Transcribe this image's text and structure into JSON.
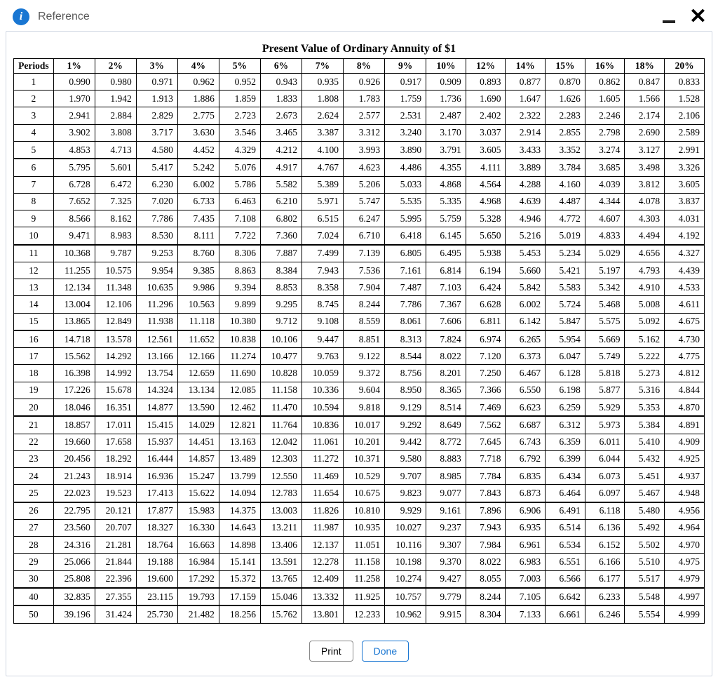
{
  "window": {
    "title": "Reference",
    "info_glyph": "i",
    "minimize_label": "minimize",
    "close_label": "close"
  },
  "table": {
    "title": "Present Value of Ordinary Annuity of $1",
    "periods_header": "Periods",
    "rate_headers": [
      "1%",
      "2%",
      "3%",
      "4%",
      "5%",
      "6%",
      "7%",
      "8%",
      "9%",
      "10%",
      "12%",
      "14%",
      "15%",
      "16%",
      "18%",
      "20%"
    ]
  },
  "buttons": {
    "print": "Print",
    "done": "Done"
  },
  "chart_data": {
    "type": "table",
    "title": "Present Value of Ordinary Annuity of $1",
    "x": [
      "1%",
      "2%",
      "3%",
      "4%",
      "5%",
      "6%",
      "7%",
      "8%",
      "9%",
      "10%",
      "12%",
      "14%",
      "15%",
      "16%",
      "18%",
      "20%"
    ],
    "periods": [
      1,
      2,
      3,
      4,
      5,
      6,
      7,
      8,
      9,
      10,
      11,
      12,
      13,
      14,
      15,
      16,
      17,
      18,
      19,
      20,
      21,
      22,
      23,
      24,
      25,
      26,
      27,
      28,
      29,
      30,
      40,
      50
    ],
    "group_starts": [
      6,
      11,
      16,
      21,
      26,
      40,
      50
    ],
    "rows": [
      {
        "period": 1,
        "values": [
          0.99,
          0.98,
          0.971,
          0.962,
          0.952,
          0.943,
          0.935,
          0.926,
          0.917,
          0.909,
          0.893,
          0.877,
          0.87,
          0.862,
          0.847,
          0.833
        ]
      },
      {
        "period": 2,
        "values": [
          1.97,
          1.942,
          1.913,
          1.886,
          1.859,
          1.833,
          1.808,
          1.783,
          1.759,
          1.736,
          1.69,
          1.647,
          1.626,
          1.605,
          1.566,
          1.528
        ]
      },
      {
        "period": 3,
        "values": [
          2.941,
          2.884,
          2.829,
          2.775,
          2.723,
          2.673,
          2.624,
          2.577,
          2.531,
          2.487,
          2.402,
          2.322,
          2.283,
          2.246,
          2.174,
          2.106
        ]
      },
      {
        "period": 4,
        "values": [
          3.902,
          3.808,
          3.717,
          3.63,
          3.546,
          3.465,
          3.387,
          3.312,
          3.24,
          3.17,
          3.037,
          2.914,
          2.855,
          2.798,
          2.69,
          2.589
        ]
      },
      {
        "period": 5,
        "values": [
          4.853,
          4.713,
          4.58,
          4.452,
          4.329,
          4.212,
          4.1,
          3.993,
          3.89,
          3.791,
          3.605,
          3.433,
          3.352,
          3.274,
          3.127,
          2.991
        ]
      },
      {
        "period": 6,
        "values": [
          5.795,
          5.601,
          5.417,
          5.242,
          5.076,
          4.917,
          4.767,
          4.623,
          4.486,
          4.355,
          4.111,
          3.889,
          3.784,
          3.685,
          3.498,
          3.326
        ]
      },
      {
        "period": 7,
        "values": [
          6.728,
          6.472,
          6.23,
          6.002,
          5.786,
          5.582,
          5.389,
          5.206,
          5.033,
          4.868,
          4.564,
          4.288,
          4.16,
          4.039,
          3.812,
          3.605
        ]
      },
      {
        "period": 8,
        "values": [
          7.652,
          7.325,
          7.02,
          6.733,
          6.463,
          6.21,
          5.971,
          5.747,
          5.535,
          5.335,
          4.968,
          4.639,
          4.487,
          4.344,
          4.078,
          3.837
        ]
      },
      {
        "period": 9,
        "values": [
          8.566,
          8.162,
          7.786,
          7.435,
          7.108,
          6.802,
          6.515,
          6.247,
          5.995,
          5.759,
          5.328,
          4.946,
          4.772,
          4.607,
          4.303,
          4.031
        ]
      },
      {
        "period": 10,
        "values": [
          9.471,
          8.983,
          8.53,
          8.111,
          7.722,
          7.36,
          7.024,
          6.71,
          6.418,
          6.145,
          5.65,
          5.216,
          5.019,
          4.833,
          4.494,
          4.192
        ]
      },
      {
        "period": 11,
        "values": [
          10.368,
          9.787,
          9.253,
          8.76,
          8.306,
          7.887,
          7.499,
          7.139,
          6.805,
          6.495,
          5.938,
          5.453,
          5.234,
          5.029,
          4.656,
          4.327
        ]
      },
      {
        "period": 12,
        "values": [
          11.255,
          10.575,
          9.954,
          9.385,
          8.863,
          8.384,
          7.943,
          7.536,
          7.161,
          6.814,
          6.194,
          5.66,
          5.421,
          5.197,
          4.793,
          4.439
        ]
      },
      {
        "period": 13,
        "values": [
          12.134,
          11.348,
          10.635,
          9.986,
          9.394,
          8.853,
          8.358,
          7.904,
          7.487,
          7.103,
          6.424,
          5.842,
          5.583,
          5.342,
          4.91,
          4.533
        ]
      },
      {
        "period": 14,
        "values": [
          13.004,
          12.106,
          11.296,
          10.563,
          9.899,
          9.295,
          8.745,
          8.244,
          7.786,
          7.367,
          6.628,
          6.002,
          5.724,
          5.468,
          5.008,
          4.611
        ]
      },
      {
        "period": 15,
        "values": [
          13.865,
          12.849,
          11.938,
          11.118,
          10.38,
          9.712,
          9.108,
          8.559,
          8.061,
          7.606,
          6.811,
          6.142,
          5.847,
          5.575,
          5.092,
          4.675
        ]
      },
      {
        "period": 16,
        "values": [
          14.718,
          13.578,
          12.561,
          11.652,
          10.838,
          10.106,
          9.447,
          8.851,
          8.313,
          7.824,
          6.974,
          6.265,
          5.954,
          5.669,
          5.162,
          4.73
        ]
      },
      {
        "period": 17,
        "values": [
          15.562,
          14.292,
          13.166,
          12.166,
          11.274,
          10.477,
          9.763,
          9.122,
          8.544,
          8.022,
          7.12,
          6.373,
          6.047,
          5.749,
          5.222,
          4.775
        ]
      },
      {
        "period": 18,
        "values": [
          16.398,
          14.992,
          13.754,
          12.659,
          11.69,
          10.828,
          10.059,
          9.372,
          8.756,
          8.201,
          7.25,
          6.467,
          6.128,
          5.818,
          5.273,
          4.812
        ]
      },
      {
        "period": 19,
        "values": [
          17.226,
          15.678,
          14.324,
          13.134,
          12.085,
          11.158,
          10.336,
          9.604,
          8.95,
          8.365,
          7.366,
          6.55,
          6.198,
          5.877,
          5.316,
          4.844
        ]
      },
      {
        "period": 20,
        "values": [
          18.046,
          16.351,
          14.877,
          13.59,
          12.462,
          11.47,
          10.594,
          9.818,
          9.129,
          8.514,
          7.469,
          6.623,
          6.259,
          5.929,
          5.353,
          4.87
        ]
      },
      {
        "period": 21,
        "values": [
          18.857,
          17.011,
          15.415,
          14.029,
          12.821,
          11.764,
          10.836,
          10.017,
          9.292,
          8.649,
          7.562,
          6.687,
          6.312,
          5.973,
          5.384,
          4.891
        ]
      },
      {
        "period": 22,
        "values": [
          19.66,
          17.658,
          15.937,
          14.451,
          13.163,
          12.042,
          11.061,
          10.201,
          9.442,
          8.772,
          7.645,
          6.743,
          6.359,
          6.011,
          5.41,
          4.909
        ]
      },
      {
        "period": 23,
        "values": [
          20.456,
          18.292,
          16.444,
          14.857,
          13.489,
          12.303,
          11.272,
          10.371,
          9.58,
          8.883,
          7.718,
          6.792,
          6.399,
          6.044,
          5.432,
          4.925
        ]
      },
      {
        "period": 24,
        "values": [
          21.243,
          18.914,
          16.936,
          15.247,
          13.799,
          12.55,
          11.469,
          10.529,
          9.707,
          8.985,
          7.784,
          6.835,
          6.434,
          6.073,
          5.451,
          4.937
        ]
      },
      {
        "period": 25,
        "values": [
          22.023,
          19.523,
          17.413,
          15.622,
          14.094,
          12.783,
          11.654,
          10.675,
          9.823,
          9.077,
          7.843,
          6.873,
          6.464,
          6.097,
          5.467,
          4.948
        ]
      },
      {
        "period": 26,
        "values": [
          22.795,
          20.121,
          17.877,
          15.983,
          14.375,
          13.003,
          11.826,
          10.81,
          9.929,
          9.161,
          7.896,
          6.906,
          6.491,
          6.118,
          5.48,
          4.956
        ]
      },
      {
        "period": 27,
        "values": [
          23.56,
          20.707,
          18.327,
          16.33,
          14.643,
          13.211,
          11.987,
          10.935,
          10.027,
          9.237,
          7.943,
          6.935,
          6.514,
          6.136,
          5.492,
          4.964
        ]
      },
      {
        "period": 28,
        "values": [
          24.316,
          21.281,
          18.764,
          16.663,
          14.898,
          13.406,
          12.137,
          11.051,
          10.116,
          9.307,
          7.984,
          6.961,
          6.534,
          6.152,
          5.502,
          4.97
        ]
      },
      {
        "period": 29,
        "values": [
          25.066,
          21.844,
          19.188,
          16.984,
          15.141,
          13.591,
          12.278,
          11.158,
          10.198,
          9.37,
          8.022,
          6.983,
          6.551,
          6.166,
          5.51,
          4.975
        ]
      },
      {
        "period": 30,
        "values": [
          25.808,
          22.396,
          19.6,
          17.292,
          15.372,
          13.765,
          12.409,
          11.258,
          10.274,
          9.427,
          8.055,
          7.003,
          6.566,
          6.177,
          5.517,
          4.979
        ]
      },
      {
        "period": 40,
        "values": [
          32.835,
          27.355,
          23.115,
          19.793,
          17.159,
          15.046,
          13.332,
          11.925,
          10.757,
          9.779,
          8.244,
          7.105,
          6.642,
          6.233,
          5.548,
          4.997
        ]
      },
      {
        "period": 50,
        "values": [
          39.196,
          31.424,
          25.73,
          21.482,
          18.256,
          15.762,
          13.801,
          12.233,
          10.962,
          9.915,
          8.304,
          7.133,
          6.661,
          6.246,
          5.554,
          4.999
        ]
      }
    ]
  }
}
